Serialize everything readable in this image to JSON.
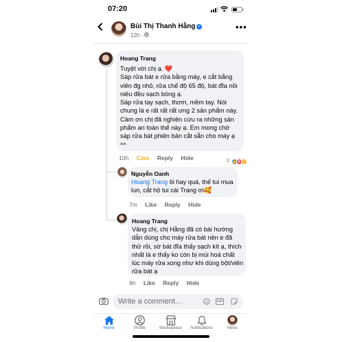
{
  "status_bar": {
    "time": "07:20"
  },
  "header": {
    "back_icon": "chevron-left",
    "name": "Bùi Thị Thanh Hằng",
    "verified_icon": "✓",
    "time": "12h · ",
    "globe_icon": "globe",
    "more": "•••"
  },
  "comments": [
    {
      "author": "Hoang Trang",
      "paragraphs": [
        "Tuyệt vời chị ạ. ❤️",
        "Sáp rửa bát e rửa bằng máy, e cắt bằng viên đg nhỏ, rửa chế độ 65 độ, bát đĩa nồi niêu đều sạch bóng ạ.",
        "Sáp rửa tay sạch, thơm, mềm tay. Nói chung là e rất rất rất ưng 2 sản phẩm này. Cảm ơn chị đã nghiên cứu ra những sản phẩm an toàn thế này ạ. Em mong chờ sáp rửa bát phiên bản cắt sẵn cho máy ạ ^^"
      ],
      "time": "10h",
      "reaction_label": "Care",
      "reply": "Reply",
      "hide": "Hide",
      "reaction_count": "2"
    },
    {
      "author": "Nguyễn Oanh",
      "mention": "Hoang Trang",
      "text": " ôi hay quá, thế tui mua lun, cắt hộ tui cái Trang ơi🥰",
      "time": "7m",
      "like": "Like",
      "reply": "Reply",
      "hide": "Hide"
    },
    {
      "author": "Hoang Trang",
      "text": "Vâng chị, chị Hằng đã có bài hướng dẫn dùng cho máy rửa bát nên e đã thử rồi, sờ bát đĩa thấy sạch kít ạ, thích nhất là e thấy ko còn bị mùi hoá chất lúc máy rửa xong như khi dùng bột/viên rửa bát ạ",
      "time": "8h",
      "like": "Like",
      "reply": "Reply",
      "hide": "Hide"
    }
  ],
  "composer": {
    "placeholder": "Write a comment…"
  },
  "nav": [
    {
      "label": "Home",
      "icon": "home-icon"
    },
    {
      "label": "Profile",
      "icon": "profile-icon"
    },
    {
      "label": "Marketplace",
      "icon": "marketplace-icon"
    },
    {
      "label": "Notifications",
      "icon": "bell-icon"
    },
    {
      "label": "Menu",
      "icon": "menu-avatar"
    }
  ],
  "colors": {
    "accent": "#1877f2",
    "care": "#f7b125",
    "bubble": "#f0f2f5",
    "muted": "#65676b"
  }
}
